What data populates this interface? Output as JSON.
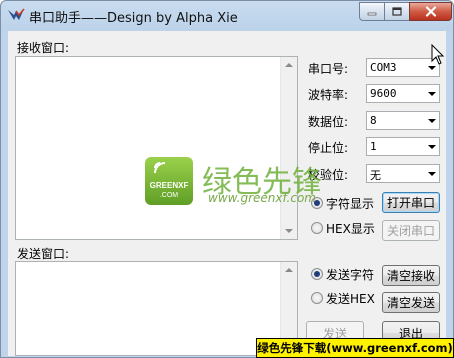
{
  "window": {
    "title": "串口助手——Design by Alpha Xie"
  },
  "receive": {
    "label": "接收窗口:"
  },
  "send": {
    "label": "发送窗口:"
  },
  "settings": {
    "port_label": "串口号:",
    "port_value": "COM3",
    "baud_label": "波特率:",
    "baud_value": "9600",
    "databits_label": "数据位:",
    "databits_value": "8",
    "stopbits_label": "停止位:",
    "stopbits_value": "1",
    "parity_label": "校验位:",
    "parity_value": "无"
  },
  "display_mode": {
    "char_label": "字符显示",
    "char_selected": true,
    "hex_label": "HEX显示",
    "hex_selected": false
  },
  "send_mode": {
    "char_label": "发送字符",
    "char_selected": true,
    "hex_label": "发送HEX",
    "hex_selected": false
  },
  "buttons": {
    "open_port": "打开串口",
    "close_port": "关闭串口",
    "clear_receive": "清空接收",
    "clear_send": "清空发送",
    "send": "发送",
    "exit": "退出"
  },
  "watermark": {
    "logo_text": "GREENXF",
    "logo_sub": ".COM",
    "brand": "绿色先锋",
    "url": "www.greenxf.com",
    "banner": "绿色先锋下载(www.greenxf.com)"
  },
  "colors": {
    "logo_green": "#7ab834",
    "brand_green": "#6fb23a"
  }
}
